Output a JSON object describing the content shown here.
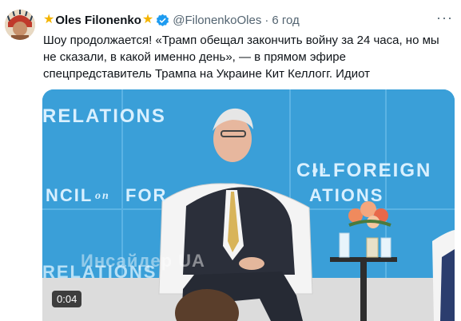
{
  "author": {
    "display_name": "Oles Filonenko",
    "name_emoji": "★",
    "handle": "@FilonenkoOles",
    "separator": "·",
    "time": "6 год",
    "verified_color": "#1d9bf0"
  },
  "tweet": {
    "text": "Шоу продолжается! «Трамп обещал закончить войну за 24 часа, но мы не сказали, в какой именно день», — в прямом эфире спецпредставитель Трампа на Украине Кит Келлогг. Идиот"
  },
  "menu": {
    "more_icon": "more-icon",
    "more_label": "···"
  },
  "media": {
    "background_text": {
      "line1": "RELATIONS",
      "line2a": "CIL",
      "line2b": "on",
      "line2c": "FOREIGN",
      "line3a": "NCIL",
      "line3b": "on",
      "line3c": "FOR",
      "line3d": "ATIONS",
      "line4": "RELATIONS"
    },
    "watermark": "Инсайдер UA",
    "duration": "0:04",
    "colors": {
      "backdrop": "#3a9fd8",
      "floor": "#f2f2f2",
      "suit": "#2b2f3a"
    }
  }
}
